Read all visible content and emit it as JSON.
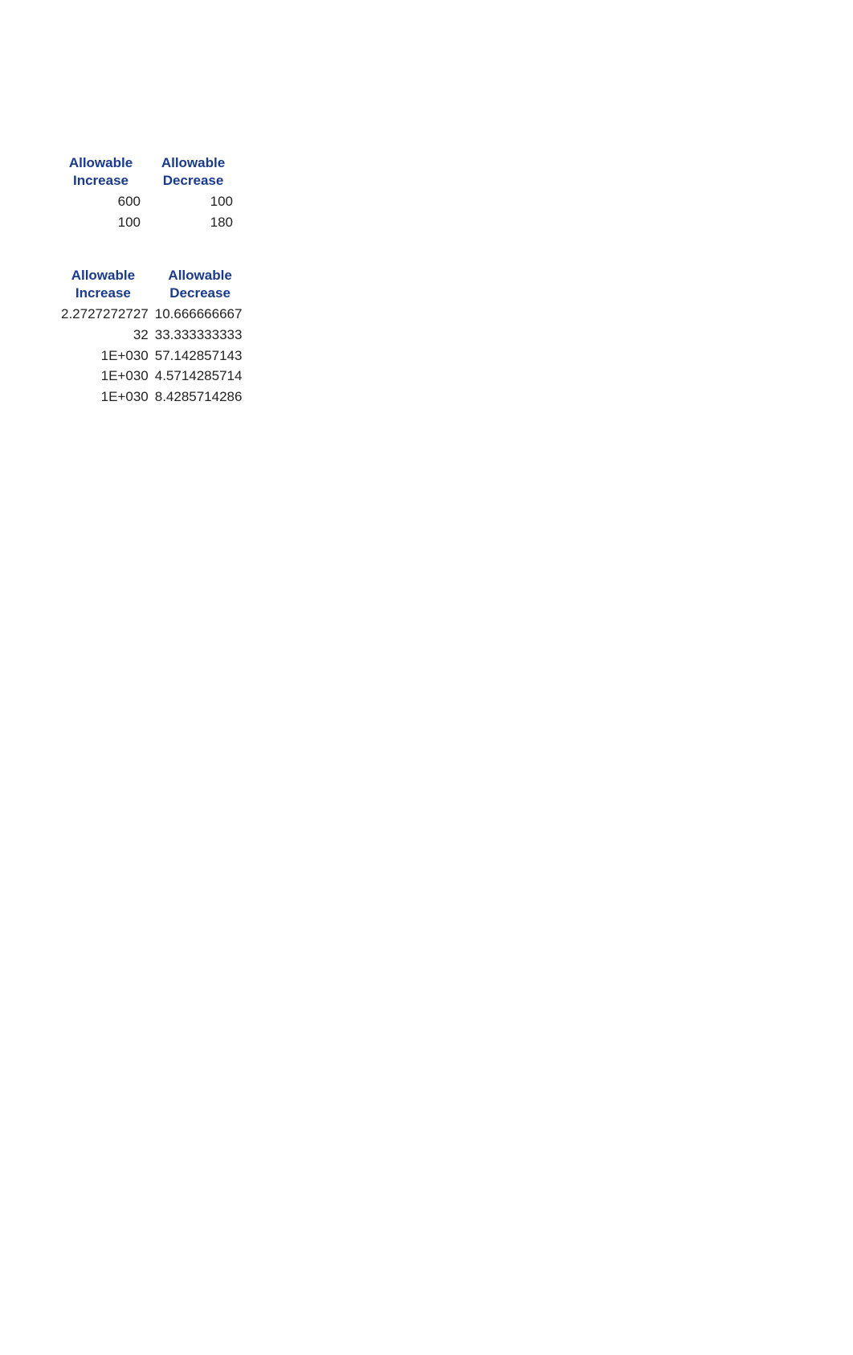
{
  "table1": {
    "headers": {
      "increase_line1": "Allowable",
      "increase_line2": "Increase",
      "decrease_line1": "Allowable",
      "decrease_line2": "Decrease"
    },
    "rows": [
      {
        "increase": "600",
        "decrease": "100"
      },
      {
        "increase": "100",
        "decrease": "180"
      }
    ]
  },
  "table2": {
    "headers": {
      "increase_line1": "Allowable",
      "increase_line2": "Increase",
      "decrease_line1": "Allowable",
      "decrease_line2": "Decrease"
    },
    "rows": [
      {
        "increase": "2.2727272727",
        "decrease": "10.666666667"
      },
      {
        "increase": "32",
        "decrease": "33.333333333"
      },
      {
        "increase": "1E+030",
        "decrease": "57.142857143"
      },
      {
        "increase": "1E+030",
        "decrease": "4.5714285714"
      },
      {
        "increase": "1E+030",
        "decrease": "8.4285714286"
      }
    ]
  }
}
